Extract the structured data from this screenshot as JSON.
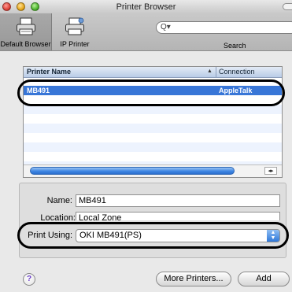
{
  "window": {
    "title": "Printer Browser"
  },
  "toolbar": {
    "default_browser_label": "Default Browser",
    "ip_printer_label": "IP Printer",
    "search_label": "Search",
    "search_placeholder": ""
  },
  "list": {
    "col_name": "Printer Name",
    "col_connection": "Connection",
    "sort_indicator": "▲",
    "rows": [
      {
        "name": "",
        "connection": ""
      },
      {
        "name": "MB491",
        "connection": "AppleTalk"
      },
      {
        "name": "",
        "connection": ""
      }
    ]
  },
  "info": {
    "name_label": "Name:",
    "name_value": "MB491",
    "location_label": "Location:",
    "location_value": "Local Zone",
    "print_using_label": "Print Using:",
    "print_using_value": "OKI MB491(PS)"
  },
  "buttons": {
    "help": "?",
    "more_printers": "More Printers...",
    "add": "Add"
  },
  "colors": {
    "selection": "#3876d7",
    "highlight_oval": "#000000"
  }
}
